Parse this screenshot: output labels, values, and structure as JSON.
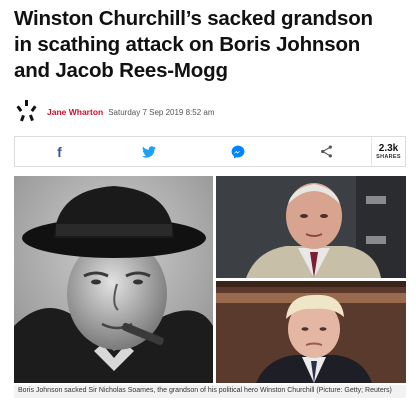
{
  "article": {
    "headline_line1": "Winston Churchill’s sacked grandson",
    "headline_line2": "in scathing attack on Boris Johnson",
    "headline_line3": "and Jacob Rees-Mogg",
    "author": "Jane Wharton",
    "date": "Saturday 7 Sep 2019 8:52 am",
    "caption": "Boris Johnson sacked Sir Nicholas Soames, the grandson of his political hero Winston Churchill (Picture: Getty; Reuters)"
  },
  "share": {
    "buttons": [
      {
        "icon": "facebook-icon",
        "glyph": "f",
        "color": "#3b5998"
      },
      {
        "icon": "twitter-icon",
        "color": "#1da1f2"
      },
      {
        "icon": "messenger-icon",
        "color": "#0084ff"
      },
      {
        "icon": "share-icon",
        "color": "#555555"
      }
    ],
    "count": "2.3k",
    "count_label": "SHARES"
  },
  "colors": {
    "author": "#c8102e",
    "border": "#dcdcdc"
  }
}
